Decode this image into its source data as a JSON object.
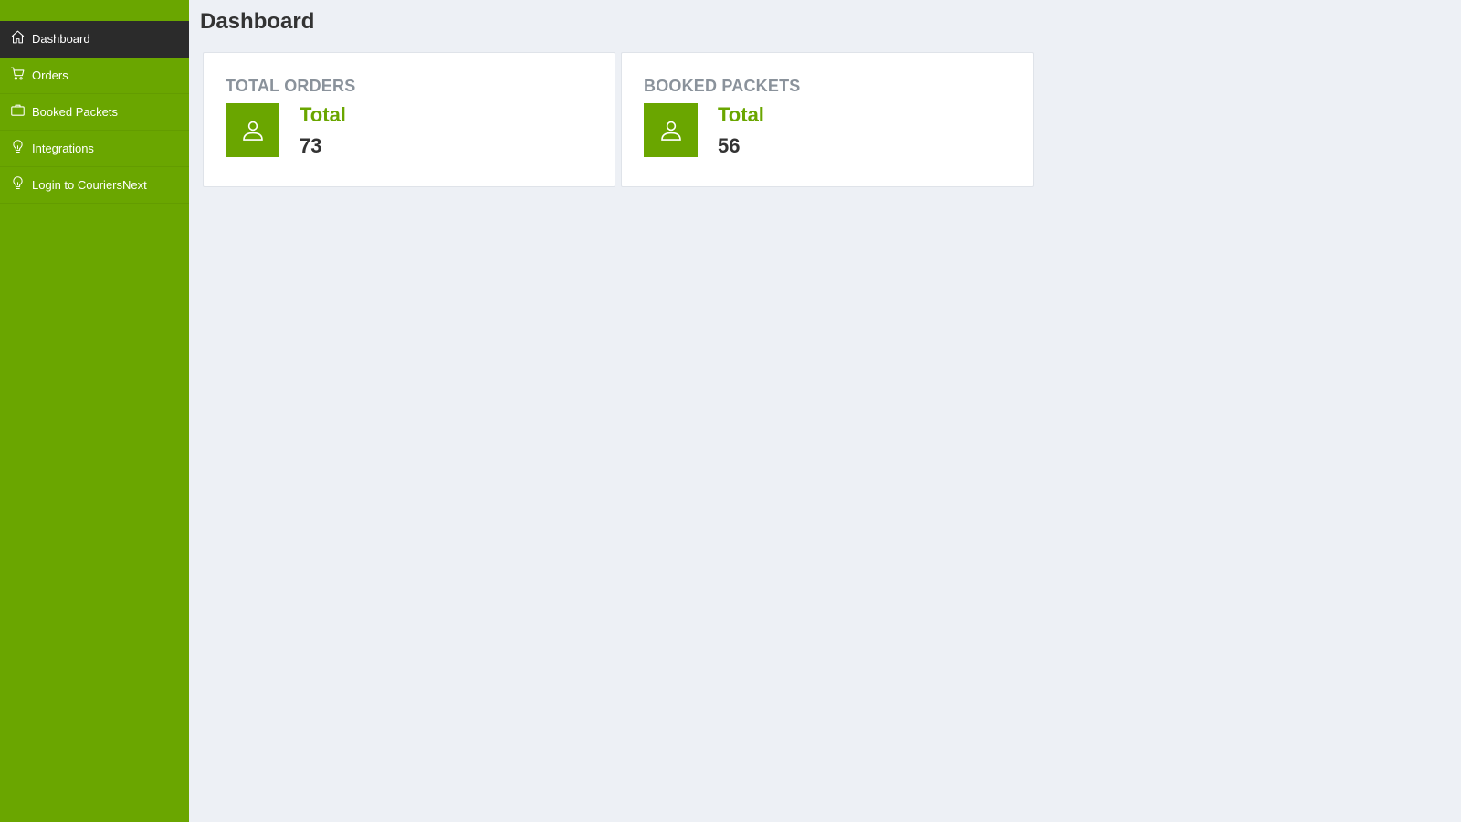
{
  "colors": {
    "brand_green": "#6aa600",
    "active_nav": "#2b2b2b",
    "background": "#edf0f5",
    "card_header": "#8a929b",
    "text_dark": "#333333"
  },
  "sidebar": {
    "items": [
      {
        "label": "Dashboard",
        "icon": "home-icon",
        "active": true
      },
      {
        "label": "Orders",
        "icon": "cart-icon",
        "active": false
      },
      {
        "label": "Booked Packets",
        "icon": "briefcase-icon",
        "active": false
      },
      {
        "label": "Integrations",
        "icon": "lightbulb-icon",
        "active": false
      },
      {
        "label": "Login to CouriersNext",
        "icon": "lightbulb-icon",
        "active": false
      }
    ]
  },
  "main": {
    "title": "Dashboard",
    "cards": [
      {
        "header": "TOTAL ORDERS",
        "icon": "user-icon",
        "label": "Total",
        "value": "73"
      },
      {
        "header": "BOOKED PACKETS",
        "icon": "user-icon",
        "label": "Total",
        "value": "56"
      }
    ]
  }
}
